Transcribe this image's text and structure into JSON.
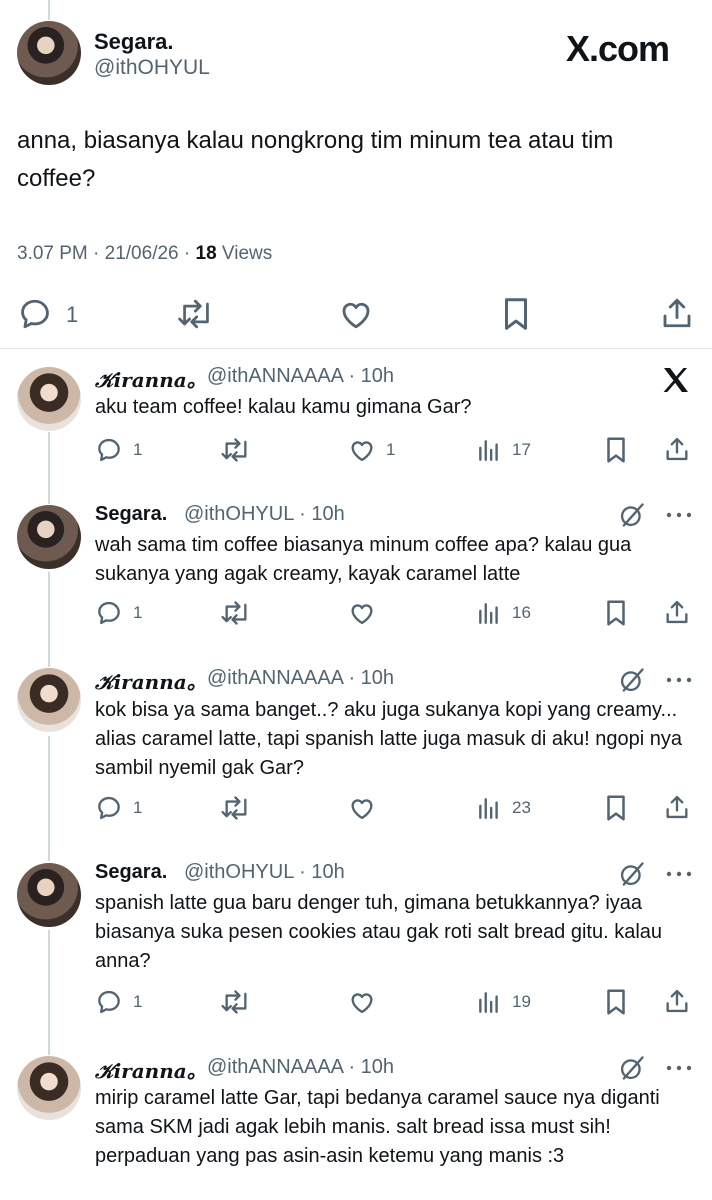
{
  "post": {
    "author_name": "Segara.",
    "author_handle": "@ithOHYUL",
    "brand": "X.com",
    "text": "anna, biasanya kalau nongkrong tim minum tea atau tim coffee?",
    "timestamp": "3.07 PM · 21/06/26 · ",
    "views_count": "18",
    "views_label": " Views",
    "reply_count": "1"
  },
  "replies": [
    {
      "name": "𝒦iranna。",
      "handle": "@ithANNAAAA · 10h",
      "text": "aku team coffee! kalau kamu gimana Gar?",
      "reply_count": "1",
      "like_count": "1",
      "view_count": "17"
    },
    {
      "name": "Segara.",
      "handle": "@ithOHYUL · 10h",
      "text": "wah sama tim coffee biasanya minum coffee apa? kalau gua sukanya yang agak creamy, kayak caramel latte",
      "reply_count": "1",
      "like_count": "",
      "view_count": "16"
    },
    {
      "name": "𝒦iranna。",
      "handle": "@ithANNAAAA · 10h",
      "text": "kok bisa ya sama banget..? aku juga sukanya kopi yang creamy... alias caramel latte, tapi spanish latte juga masuk di aku! ngopi nya sambil nyemil gak Gar?",
      "reply_count": "1",
      "like_count": "",
      "view_count": "23"
    },
    {
      "name": "Segara.",
      "handle": "@ithOHYUL · 10h",
      "text": "spanish latte gua baru denger tuh, gimana betukkannya? iyaa biasanya suka pesen cookies atau gak roti salt bread gitu. kalau anna?",
      "reply_count": "1",
      "like_count": "",
      "view_count": "19"
    },
    {
      "name": "𝒦iranna。",
      "handle": "@ithANNAAAA · 10h",
      "text": "mirip caramel latte Gar, tapi bedanya caramel sauce nya diganti sama SKM jadi agak lebih manis. salt bread issa must sih! perpaduan yang pas asin-asin ketemu yang manis :3"
    }
  ],
  "colors": {
    "text": "#0f1419",
    "secondary": "#536471",
    "divider": "#e7e9ea"
  }
}
